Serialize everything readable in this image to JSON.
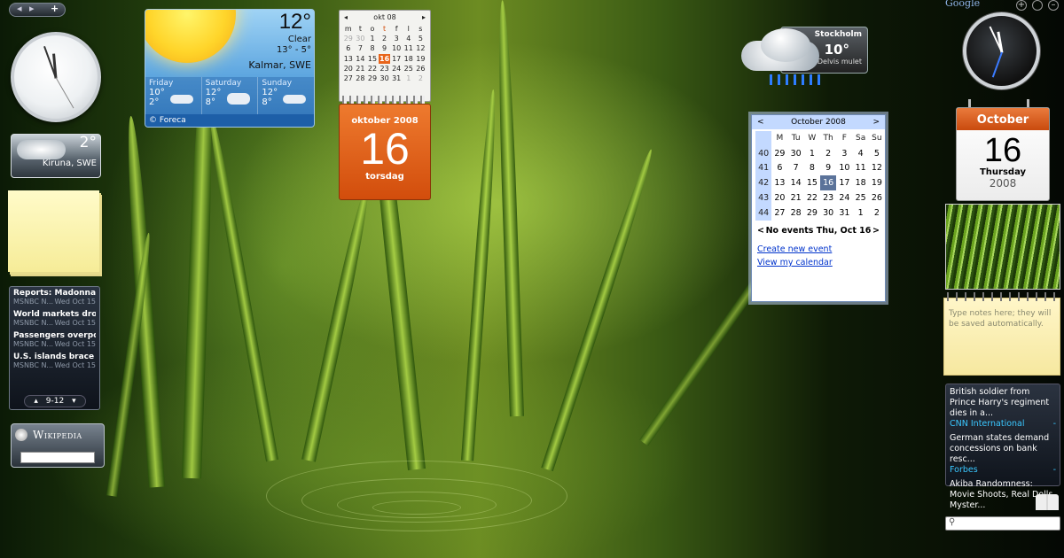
{
  "sidebar_left": {
    "control_prev": "◂",
    "control_next": "▸",
    "control_add": "+",
    "weather_temp": "2°",
    "weather_city": "Kiruna, SWE",
    "news": [
      {
        "title": "Reports: Madonna, R...",
        "source": "MSNBC N...",
        "date": "Wed Oct 15"
      },
      {
        "title": "World markets drop ...",
        "source": "MSNBC N...",
        "date": "Wed Oct 15"
      },
      {
        "title": "Passengers overpow...",
        "source": "MSNBC N...",
        "date": "Wed Oct 15"
      },
      {
        "title": "U.S. islands brace for...",
        "source": "MSNBC N...",
        "date": "Wed Oct 15"
      }
    ],
    "news_pager": "9-12",
    "wiki_logo": "Wikipedia",
    "wiki_search_value": ""
  },
  "weather_widget": {
    "temp": "12°",
    "condition": "Clear",
    "range": "13° - 5°",
    "city": "Kalmar, SWE",
    "forecast": [
      {
        "day": "Friday",
        "high": "10°",
        "low": "2°"
      },
      {
        "day": "Saturday",
        "high": "12°",
        "low": "8°"
      },
      {
        "day": "Sunday",
        "high": "12°",
        "low": "8°"
      }
    ],
    "credit": "© Foreca"
  },
  "mini_calendar": {
    "month": "okt 08",
    "day_headers": [
      "m",
      "t",
      "o",
      "t",
      "f",
      "l",
      "s"
    ],
    "weeks": [
      [
        "29",
        "30",
        "1",
        "2",
        "3",
        "4",
        "5"
      ],
      [
        "6",
        "7",
        "8",
        "9",
        "10",
        "11",
        "12"
      ],
      [
        "13",
        "14",
        "15",
        "16",
        "17",
        "18",
        "19"
      ],
      [
        "20",
        "21",
        "22",
        "23",
        "24",
        "25",
        "26"
      ],
      [
        "27",
        "28",
        "29",
        "30",
        "31",
        "1",
        "2"
      ]
    ],
    "today": "16"
  },
  "date_widget": {
    "month_year": "oktober 2008",
    "day": "16",
    "weekday": "torsdag"
  },
  "weather_top": {
    "city": "Stockholm",
    "temp": "10°",
    "note": "Delvis mulet"
  },
  "google_calendar": {
    "month": "October 2008",
    "prev": "<",
    "next": ">",
    "day_headers": [
      "M",
      "Tu",
      "W",
      "Th",
      "F",
      "Sa",
      "Su"
    ],
    "weeks": [
      {
        "wk": "40",
        "days": [
          "29",
          "30",
          "1",
          "2",
          "3",
          "4",
          "5"
        ]
      },
      {
        "wk": "41",
        "days": [
          "6",
          "7",
          "8",
          "9",
          "10",
          "11",
          "12"
        ]
      },
      {
        "wk": "42",
        "days": [
          "13",
          "14",
          "15",
          "16",
          "17",
          "18",
          "19"
        ]
      },
      {
        "wk": "43",
        "days": [
          "20",
          "21",
          "22",
          "23",
          "24",
          "25",
          "26"
        ]
      },
      {
        "wk": "44",
        "days": [
          "27",
          "28",
          "29",
          "30",
          "31",
          "1",
          "2"
        ]
      }
    ],
    "selected": "16",
    "events_label": "No events Thu, Oct 16",
    "create_link": "Create new event",
    "view_link": "View my calendar"
  },
  "sidebar_right": {
    "google_label": "Google",
    "calendar_month": "October",
    "calendar_day": "16",
    "calendar_weekday": "Thursday",
    "calendar_year": "2008",
    "notes_placeholder": "Type notes here; they will be saved automatically.",
    "news": [
      {
        "title": "British soldier from Prince Harry's regiment dies in a...",
        "source": "CNN International"
      },
      {
        "title": "German states demand concessions on bank resc...",
        "source": "Forbes"
      },
      {
        "title": "Akiba Randomness: Movie Shoots, Real Dolls, Myster...",
        "source": ""
      }
    ],
    "search_value": ""
  },
  "colors": {
    "calendar_orange": "#d24d0c",
    "gcal_header": "#c3d9ff",
    "gcal_selected": "#5b739a",
    "link_blue": "#0033cc",
    "news_source_cyan": "#3ac7ff"
  }
}
